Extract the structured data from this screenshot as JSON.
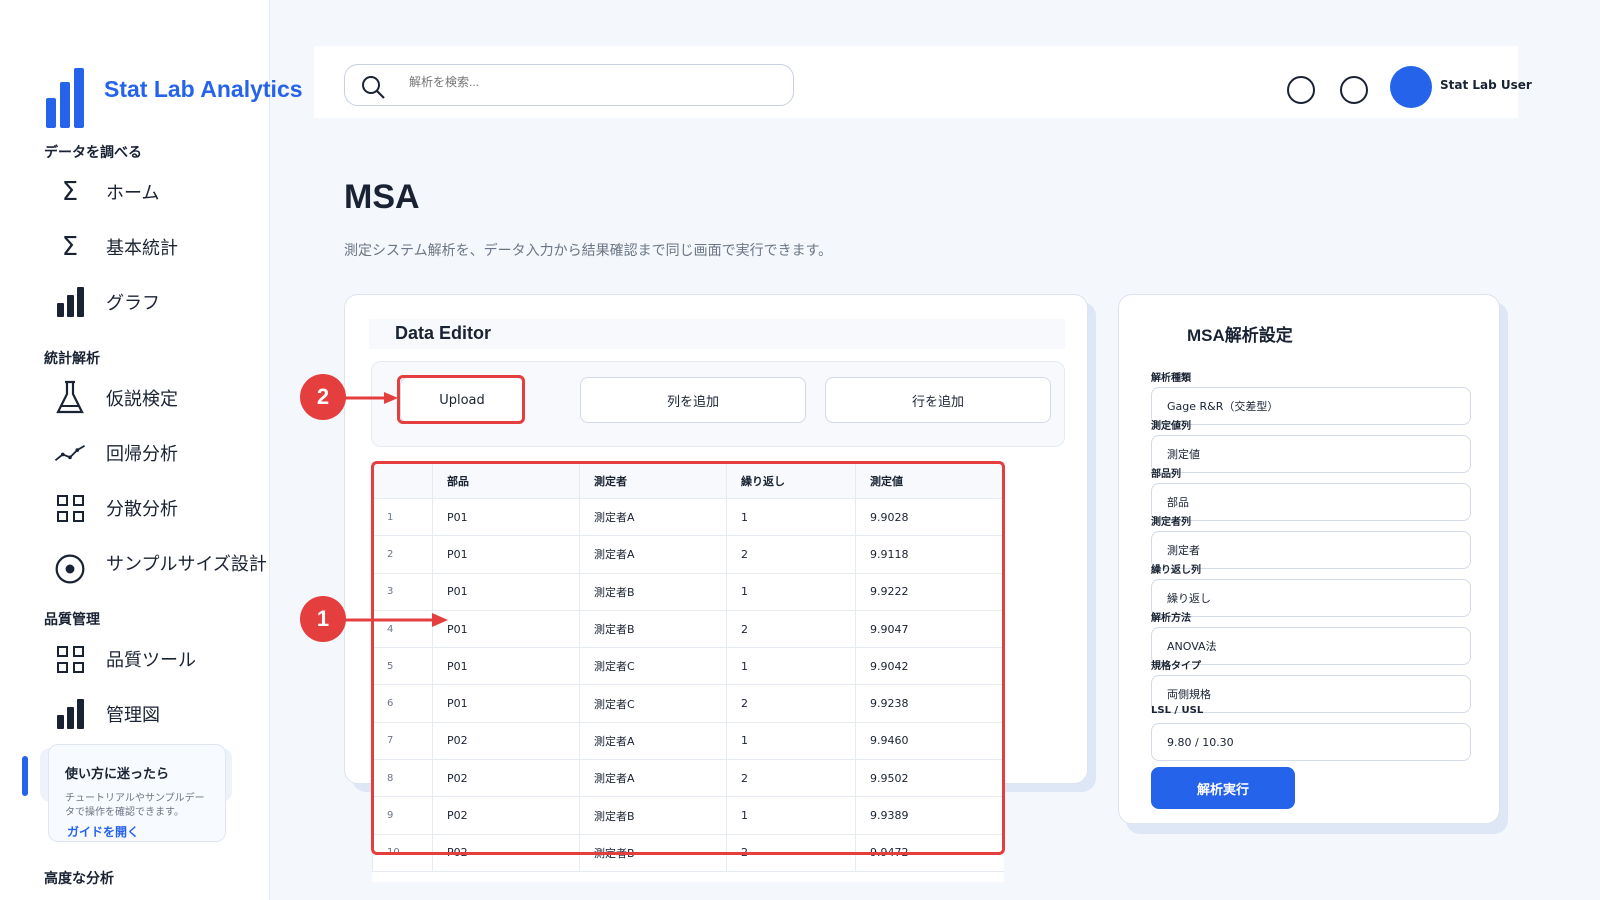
{
  "app": {
    "title": "Stat Lab Analytics"
  },
  "sidebar": {
    "sections": [
      {
        "title": "データを調べる"
      },
      {
        "title": "統計解析"
      },
      {
        "title": "品質管理"
      },
      {
        "title": "高度な分析"
      }
    ],
    "items": [
      {
        "label": "ホーム",
        "icon": "sigma-icon"
      },
      {
        "label": "基本統計",
        "icon": "sigma-icon"
      },
      {
        "label": "グラフ",
        "icon": "bar-chart-icon"
      },
      {
        "label": "仮説検定",
        "icon": "flask-icon"
      },
      {
        "label": "回帰分析",
        "icon": "trend-line-icon"
      },
      {
        "label": "分散分析",
        "icon": "grid-icon"
      },
      {
        "label": "サンプルサイズ設計",
        "icon": "target-icon"
      },
      {
        "label": "品質ツール",
        "icon": "grid-icon"
      },
      {
        "label": "管理図",
        "icon": "bar-chart-icon"
      }
    ],
    "help": {
      "title": "使い方に迷ったら",
      "text": "チュートリアルやサンプルデータで操作を確認できます。",
      "link": "ガイドを開く"
    }
  },
  "header": {
    "search_placeholder": "解析を検索...",
    "user_name": "Stat Lab User"
  },
  "page": {
    "title": "MSA",
    "description": "測定システム解析を、データ入力から結果確認まで同じ画面で実行できます。"
  },
  "editor": {
    "title": "Data Editor",
    "buttons": {
      "upload": "Upload",
      "add_column": "列を追加",
      "add_row": "行を追加"
    },
    "columns": [
      "",
      "部品",
      "測定者",
      "繰り返し",
      "測定値"
    ],
    "rows": [
      [
        "1",
        "P01",
        "測定者A",
        "1",
        "9.9028"
      ],
      [
        "2",
        "P01",
        "測定者A",
        "2",
        "9.9118"
      ],
      [
        "3",
        "P01",
        "測定者B",
        "1",
        "9.9222"
      ],
      [
        "4",
        "P01",
        "測定者B",
        "2",
        "9.9047"
      ],
      [
        "5",
        "P01",
        "測定者C",
        "1",
        "9.9042"
      ],
      [
        "6",
        "P01",
        "測定者C",
        "2",
        "9.9238"
      ],
      [
        "7",
        "P02",
        "測定者A",
        "1",
        "9.9460"
      ],
      [
        "8",
        "P02",
        "測定者A",
        "2",
        "9.9502"
      ],
      [
        "9",
        "P02",
        "測定者B",
        "1",
        "9.9389"
      ],
      [
        "10",
        "P02",
        "測定者B",
        "2",
        "9.9472"
      ]
    ]
  },
  "settings": {
    "title": "MSA解析設定",
    "fields": [
      {
        "label": "解析種類",
        "value": "Gage R&R（交差型）"
      },
      {
        "label": "測定値列",
        "value": "測定値"
      },
      {
        "label": "部品列",
        "value": "部品"
      },
      {
        "label": "測定者列",
        "value": "測定者"
      },
      {
        "label": "繰り返し列",
        "value": "繰り返し"
      },
      {
        "label": "解析方法",
        "value": "ANOVA法"
      },
      {
        "label": "規格タイプ",
        "value": "両側規格"
      },
      {
        "label": "LSL / USL",
        "value": "9.80 / 10.30"
      }
    ],
    "run_label": "解析実行"
  },
  "annotations": {
    "marker_1": "1",
    "marker_2": "2",
    "color": "#e53e3e"
  },
  "colors": {
    "accent": "#2563eb",
    "annotation": "#e53e3e"
  }
}
